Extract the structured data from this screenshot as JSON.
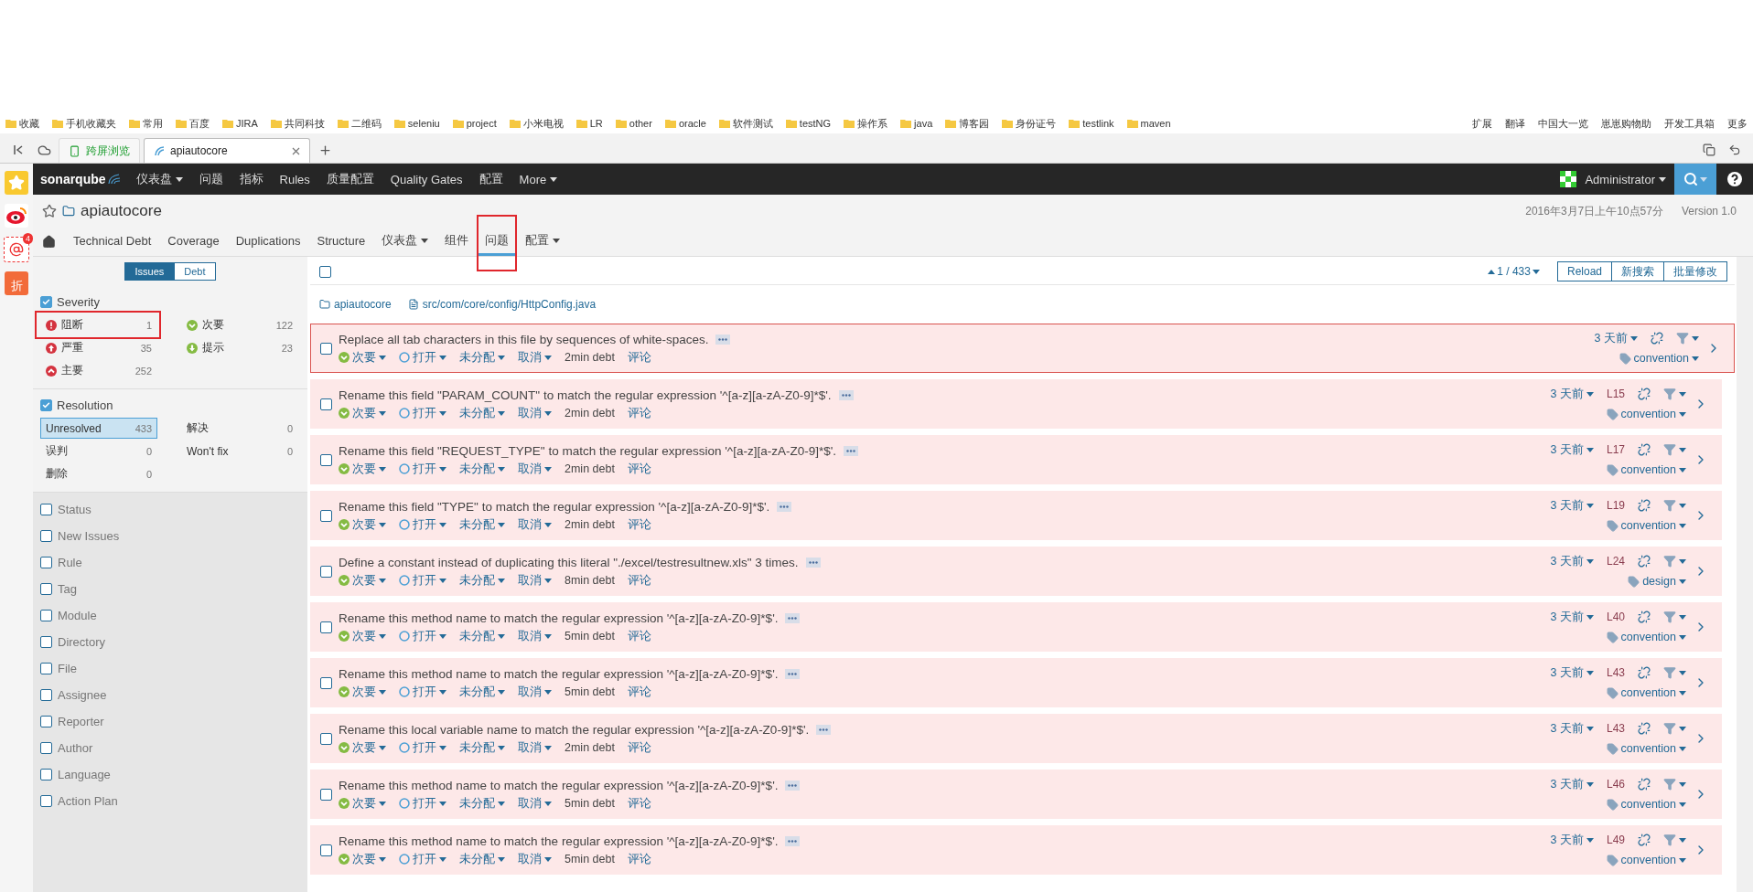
{
  "browser": {
    "bookmarks": [
      "收藏",
      "手机收藏夹",
      "常用",
      "百度",
      "JIRA",
      "共同科技",
      "二维码",
      "seleniu",
      "project",
      "小米电视",
      "LR",
      "other",
      "oracle",
      "软件测试",
      "testNG",
      "操作系",
      "java",
      "博客园",
      "身份证号",
      "testlink",
      "maven"
    ],
    "bookmarks_right": [
      "扩展",
      "翻译",
      "中国大一览",
      "崽崽购物助",
      "开发工具箱",
      "更多"
    ],
    "tabs": [
      {
        "label": "跨屏浏览",
        "kind": "app",
        "selected": false
      },
      {
        "label": "apiautocore",
        "kind": "page",
        "selected": true
      }
    ],
    "sidebar_badge": "4",
    "sidebar_discount": "折"
  },
  "nav": {
    "logo": "sonarqube",
    "items": [
      {
        "label": "仪表盘",
        "dropdown": true
      },
      {
        "label": "问题",
        "dropdown": false
      },
      {
        "label": "指标",
        "dropdown": false
      },
      {
        "label": "Rules",
        "dropdown": false
      },
      {
        "label": "质量配置",
        "dropdown": false
      },
      {
        "label": "Quality Gates",
        "dropdown": false
      },
      {
        "label": "配置",
        "dropdown": false
      },
      {
        "label": "More",
        "dropdown": true
      }
    ],
    "user": "Administrator"
  },
  "project": {
    "name": "apiautocore",
    "date": "2016年3月7日上午10点57分",
    "version": "Version 1.0",
    "tabs": [
      {
        "label": "Technical Debt",
        "dropdown": false,
        "selected": false,
        "highlighted": false
      },
      {
        "label": "Coverage",
        "dropdown": false,
        "selected": false,
        "highlighted": false
      },
      {
        "label": "Duplications",
        "dropdown": false,
        "selected": false,
        "highlighted": false
      },
      {
        "label": "Structure",
        "dropdown": false,
        "selected": false,
        "highlighted": false
      },
      {
        "label": "仪表盘",
        "dropdown": true,
        "selected": false,
        "highlighted": false
      },
      {
        "label": "组件",
        "dropdown": false,
        "selected": false,
        "highlighted": false
      },
      {
        "label": "问题",
        "dropdown": false,
        "selected": true,
        "highlighted": true
      },
      {
        "label": "配置",
        "dropdown": true,
        "selected": false,
        "highlighted": false
      }
    ]
  },
  "sidebar": {
    "mode_tabs": [
      {
        "label": "Issues",
        "selected": true
      },
      {
        "label": "Debt",
        "selected": false
      }
    ],
    "facets": [
      {
        "title": "Severity",
        "checked": true,
        "items": [
          {
            "label": "阻断",
            "count": "1",
            "kind": "blocker",
            "selected": false,
            "highlighted": true
          },
          {
            "label": "次要",
            "count": "122",
            "kind": "minor",
            "selected": false,
            "highlighted": false
          },
          {
            "label": "严重",
            "count": "35",
            "kind": "critical",
            "selected": false,
            "highlighted": false
          },
          {
            "label": "提示",
            "count": "23",
            "kind": "info",
            "selected": false,
            "highlighted": false
          },
          {
            "label": "主要",
            "count": "252",
            "kind": "major",
            "selected": false,
            "highlighted": false
          }
        ]
      },
      {
        "title": "Resolution",
        "checked": true,
        "items": [
          {
            "label": "Unresolved",
            "count": "433",
            "selected": true,
            "highlighted": false
          },
          {
            "label": "解决",
            "count": "0",
            "selected": false,
            "highlighted": false
          },
          {
            "label": "误判",
            "count": "0",
            "selected": false,
            "highlighted": false
          },
          {
            "label": "Won't fix",
            "count": "0",
            "selected": false,
            "highlighted": false
          },
          {
            "label": "删除",
            "count": "0",
            "selected": false,
            "highlighted": false
          }
        ]
      }
    ],
    "closed_facets": [
      {
        "title": "Status",
        "checked": false
      },
      {
        "title": "New Issues",
        "checked": false
      },
      {
        "title": "Rule",
        "checked": false
      },
      {
        "title": "Tag",
        "checked": false
      },
      {
        "title": "Module",
        "checked": false
      },
      {
        "title": "Directory",
        "checked": false
      },
      {
        "title": "File",
        "checked": false
      },
      {
        "title": "Assignee",
        "checked": false
      },
      {
        "title": "Reporter",
        "checked": false
      },
      {
        "title": "Author",
        "checked": false
      },
      {
        "title": "Language",
        "checked": false
      },
      {
        "title": "Action Plan",
        "checked": false
      }
    ]
  },
  "toolbar": {
    "select_all": false,
    "counter": "1 / 433",
    "buttons": [
      "Reload",
      "新搜索",
      "批量修改"
    ]
  },
  "breadcrumb": {
    "project": "apiautocore",
    "file": "src/com/core/config/HttpConfig.java"
  },
  "issues": [
    {
      "message": "Replace all tab characters in this file by sequences of white-spaces.",
      "severity": "次要",
      "kind": "minor",
      "status": "打开",
      "assignee": "未分配",
      "plan": "取消",
      "debt": "2min debt",
      "comment": "评论",
      "age": "3 天前",
      "tag": "convention",
      "selected": true,
      "checked": false
    },
    {
      "message": "Rename this field \"PARAM_COUNT\" to match the regular expression '^[a-z][a-zA-Z0-9]*$'.",
      "severity": "次要",
      "kind": "minor",
      "status": "打开",
      "assignee": "未分配",
      "plan": "取消",
      "debt": "2min debt",
      "comment": "评论",
      "age": "3 天前",
      "line": "L15",
      "tag": "convention",
      "selected": false,
      "checked": false
    },
    {
      "message": "Rename this field \"REQUEST_TYPE\" to match the regular expression '^[a-z][a-zA-Z0-9]*$'.",
      "severity": "次要",
      "kind": "minor",
      "status": "打开",
      "assignee": "未分配",
      "plan": "取消",
      "debt": "2min debt",
      "comment": "评论",
      "age": "3 天前",
      "line": "L17",
      "tag": "convention",
      "selected": false,
      "checked": false
    },
    {
      "message": "Rename this field \"TYPE\" to match the regular expression '^[a-z][a-zA-Z0-9]*$'.",
      "severity": "次要",
      "kind": "minor",
      "status": "打开",
      "assignee": "未分配",
      "plan": "取消",
      "debt": "2min debt",
      "comment": "评论",
      "age": "3 天前",
      "line": "L19",
      "tag": "convention",
      "selected": false,
      "checked": false
    },
    {
      "message": "Define a constant instead of duplicating this literal \"./excel/testresultnew.xls\" 3 times.",
      "severity": "次要",
      "kind": "minor",
      "status": "打开",
      "assignee": "未分配",
      "plan": "取消",
      "debt": "8min debt",
      "comment": "评论",
      "age": "3 天前",
      "line": "L24",
      "tag": "design",
      "selected": false,
      "checked": false
    },
    {
      "message": "Rename this method name to match the regular expression '^[a-z][a-zA-Z0-9]*$'.",
      "severity": "次要",
      "kind": "minor",
      "status": "打开",
      "assignee": "未分配",
      "plan": "取消",
      "debt": "5min debt",
      "comment": "评论",
      "age": "3 天前",
      "line": "L40",
      "tag": "convention",
      "selected": false,
      "checked": false
    },
    {
      "message": "Rename this method name to match the regular expression '^[a-z][a-zA-Z0-9]*$'.",
      "severity": "次要",
      "kind": "minor",
      "status": "打开",
      "assignee": "未分配",
      "plan": "取消",
      "debt": "5min debt",
      "comment": "评论",
      "age": "3 天前",
      "line": "L43",
      "tag": "convention",
      "selected": false,
      "checked": false
    },
    {
      "message": "Rename this local variable name to match the regular expression '^[a-z][a-zA-Z0-9]*$'.",
      "severity": "次要",
      "kind": "minor",
      "status": "打开",
      "assignee": "未分配",
      "plan": "取消",
      "debt": "2min debt",
      "comment": "评论",
      "age": "3 天前",
      "line": "L43",
      "tag": "convention",
      "selected": false,
      "checked": false
    },
    {
      "message": "Rename this method name to match the regular expression '^[a-z][a-zA-Z0-9]*$'.",
      "severity": "次要",
      "kind": "minor",
      "status": "打开",
      "assignee": "未分配",
      "plan": "取消",
      "debt": "5min debt",
      "comment": "评论",
      "age": "3 天前",
      "line": "L46",
      "tag": "convention",
      "selected": false,
      "checked": false
    },
    {
      "message": "Rename this method name to match the regular expression '^[a-z][a-zA-Z0-9]*$'.",
      "severity": "次要",
      "kind": "minor",
      "status": "打开",
      "assignee": "未分配",
      "plan": "取消",
      "debt": "5min debt",
      "comment": "评论",
      "age": "3 天前",
      "line": "L49",
      "tag": "convention",
      "selected": false,
      "checked": false
    }
  ]
}
